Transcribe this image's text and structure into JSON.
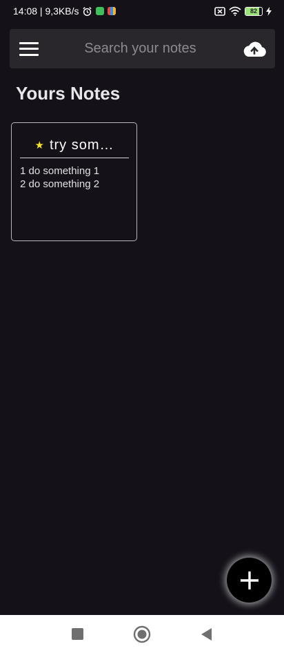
{
  "status_bar": {
    "time_speed": "14:08 | 9,3KB/s",
    "battery_level": "82",
    "battery_fraction": 0.82,
    "icons": [
      "alarm-icon",
      "app-badge-green-icon",
      "app-badge-multicolor-icon",
      "no-sim-icon",
      "wifi-icon",
      "battery-icon",
      "charging-bolt-icon"
    ]
  },
  "search": {
    "placeholder": "Search your notes",
    "value": ""
  },
  "page": {
    "title": "Yours Notes"
  },
  "notes": [
    {
      "starred": true,
      "title": "try som…",
      "lines": [
        "1 do something 1",
        "2 do something 2"
      ]
    }
  ],
  "colors": {
    "background": "#141218",
    "search_bar": "#29272b",
    "star": "#f5e42c",
    "battery_fill": "#9be37a"
  },
  "nav": {
    "items": [
      "recents-square-icon",
      "home-circle-icon",
      "back-triangle-icon"
    ]
  }
}
